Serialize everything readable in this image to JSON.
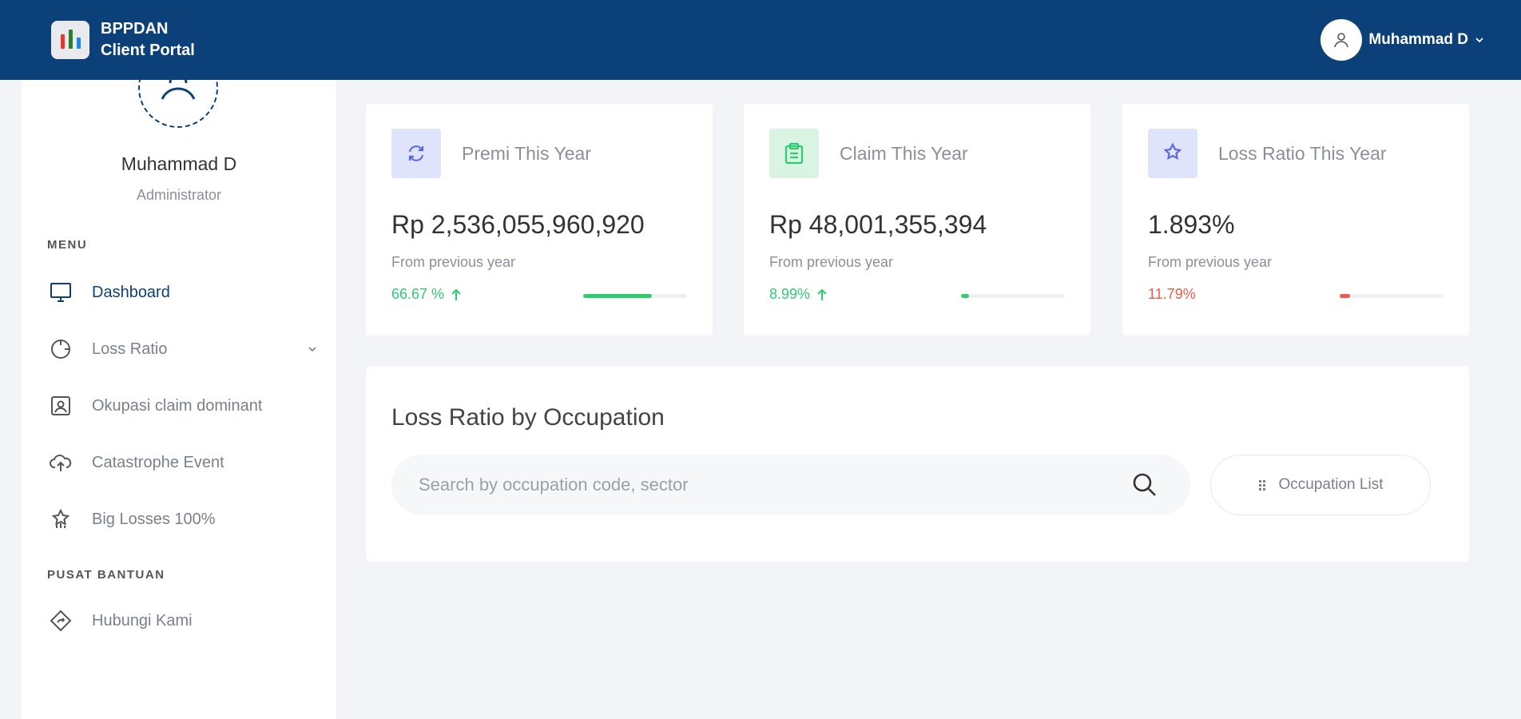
{
  "header": {
    "brand_line1": "BPPDAN",
    "brand_line2": "Client Portal",
    "user_name": "Muhammad D",
    "logo_bar_colors": [
      "#e53935",
      "#2e7d32",
      "#1e88e5"
    ],
    "background": "#0b4079"
  },
  "sidebar": {
    "profile_name": "Muhammad D",
    "profile_role": "Administrator",
    "menu_label": "MENU",
    "help_label": "PUSAT BANTUAN",
    "items": [
      {
        "label": "Dashboard",
        "icon": "monitor-icon"
      },
      {
        "label": "Loss Ratio",
        "icon": "circle-chart-icon"
      },
      {
        "label": "Okupasi claim dominant",
        "icon": "id-card-icon"
      },
      {
        "label": "Catastrophe Event",
        "icon": "cloud-upload-icon"
      },
      {
        "label": "Big Losses 100%",
        "icon": "star-chart-icon"
      }
    ],
    "help_items": [
      {
        "label": "Hubungi Kami",
        "icon": "diamond-icon"
      }
    ]
  },
  "stats": [
    {
      "title": "Premi This Year",
      "value": "Rp 2,536,055,960,920",
      "sub": "From previous year",
      "change": "66.67 %",
      "trend": "up",
      "progress": 0.66,
      "change_color": "#2ecc71",
      "icon": "refresh-icon",
      "icon_bg": "#dfe3fb",
      "icon_color": "#5a6be0"
    },
    {
      "title": "Claim This Year",
      "value": "Rp 48,001,355,394",
      "sub": "From previous year",
      "change": "8.99%",
      "trend": "up",
      "progress": 0.08,
      "change_color": "#2ecc71",
      "icon": "clipboard-icon",
      "icon_bg": "#d9f4e3",
      "icon_color": "#2ecc71"
    },
    {
      "title": "Loss Ratio This Year",
      "value": "1.893%",
      "sub": "From previous year",
      "change": "11.79%",
      "trend": "none",
      "progress": 0.1,
      "change_color": "#f05a4a",
      "icon": "star-chart-icon",
      "icon_bg": "#dfe3fb",
      "icon_color": "#5a6be0"
    }
  ],
  "occupation": {
    "title": "Loss Ratio by Occupation",
    "search_placeholder": "Search by occupation code, sector",
    "search_value": "",
    "list_button": "Occupation List"
  }
}
